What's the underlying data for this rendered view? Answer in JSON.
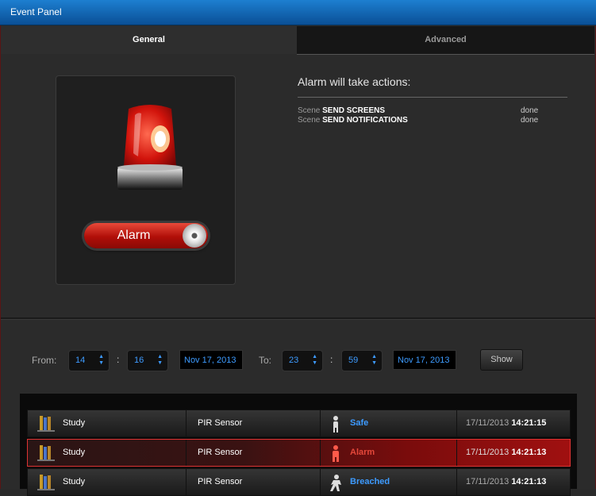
{
  "window": {
    "title": "Event Panel"
  },
  "tabs": [
    {
      "label": "General",
      "active": true
    },
    {
      "label": "Advanced",
      "active": false
    }
  ],
  "alarm": {
    "button_label": "Alarm"
  },
  "actions": {
    "title": "Alarm will take actions:",
    "items": [
      {
        "prefix": "Scene",
        "name": "SEND SCREENS",
        "status": "done"
      },
      {
        "prefix": "Scene",
        "name": "SEND NOTIFICATIONS",
        "status": "done"
      }
    ]
  },
  "filter": {
    "from_label": "From:",
    "from_hour": "14",
    "from_minute": "16",
    "from_date": "Nov 17, 2013",
    "to_label": "To:",
    "to_hour": "23",
    "to_minute": "59",
    "to_date": "Nov 17, 2013",
    "separator": ":",
    "show_label": "Show"
  },
  "events": [
    {
      "room": "Study",
      "sensor": "PIR Sensor",
      "state": "Safe",
      "state_color": "#3d9bff",
      "date": "17/11/2013",
      "time": "14:21:15",
      "icon": "person-safe-icon"
    },
    {
      "room": "Study",
      "sensor": "PIR Sensor",
      "state": "Alarm",
      "state_color": "#e5483a",
      "date": "17/11/2013",
      "time": "14:21:13",
      "icon": "person-alarm-icon"
    },
    {
      "room": "Study",
      "sensor": "PIR Sensor",
      "state": "Breached",
      "state_color": "#3d9bff",
      "date": "17/11/2013",
      "time": "14:21:13",
      "icon": "person-breached-icon"
    }
  ]
}
